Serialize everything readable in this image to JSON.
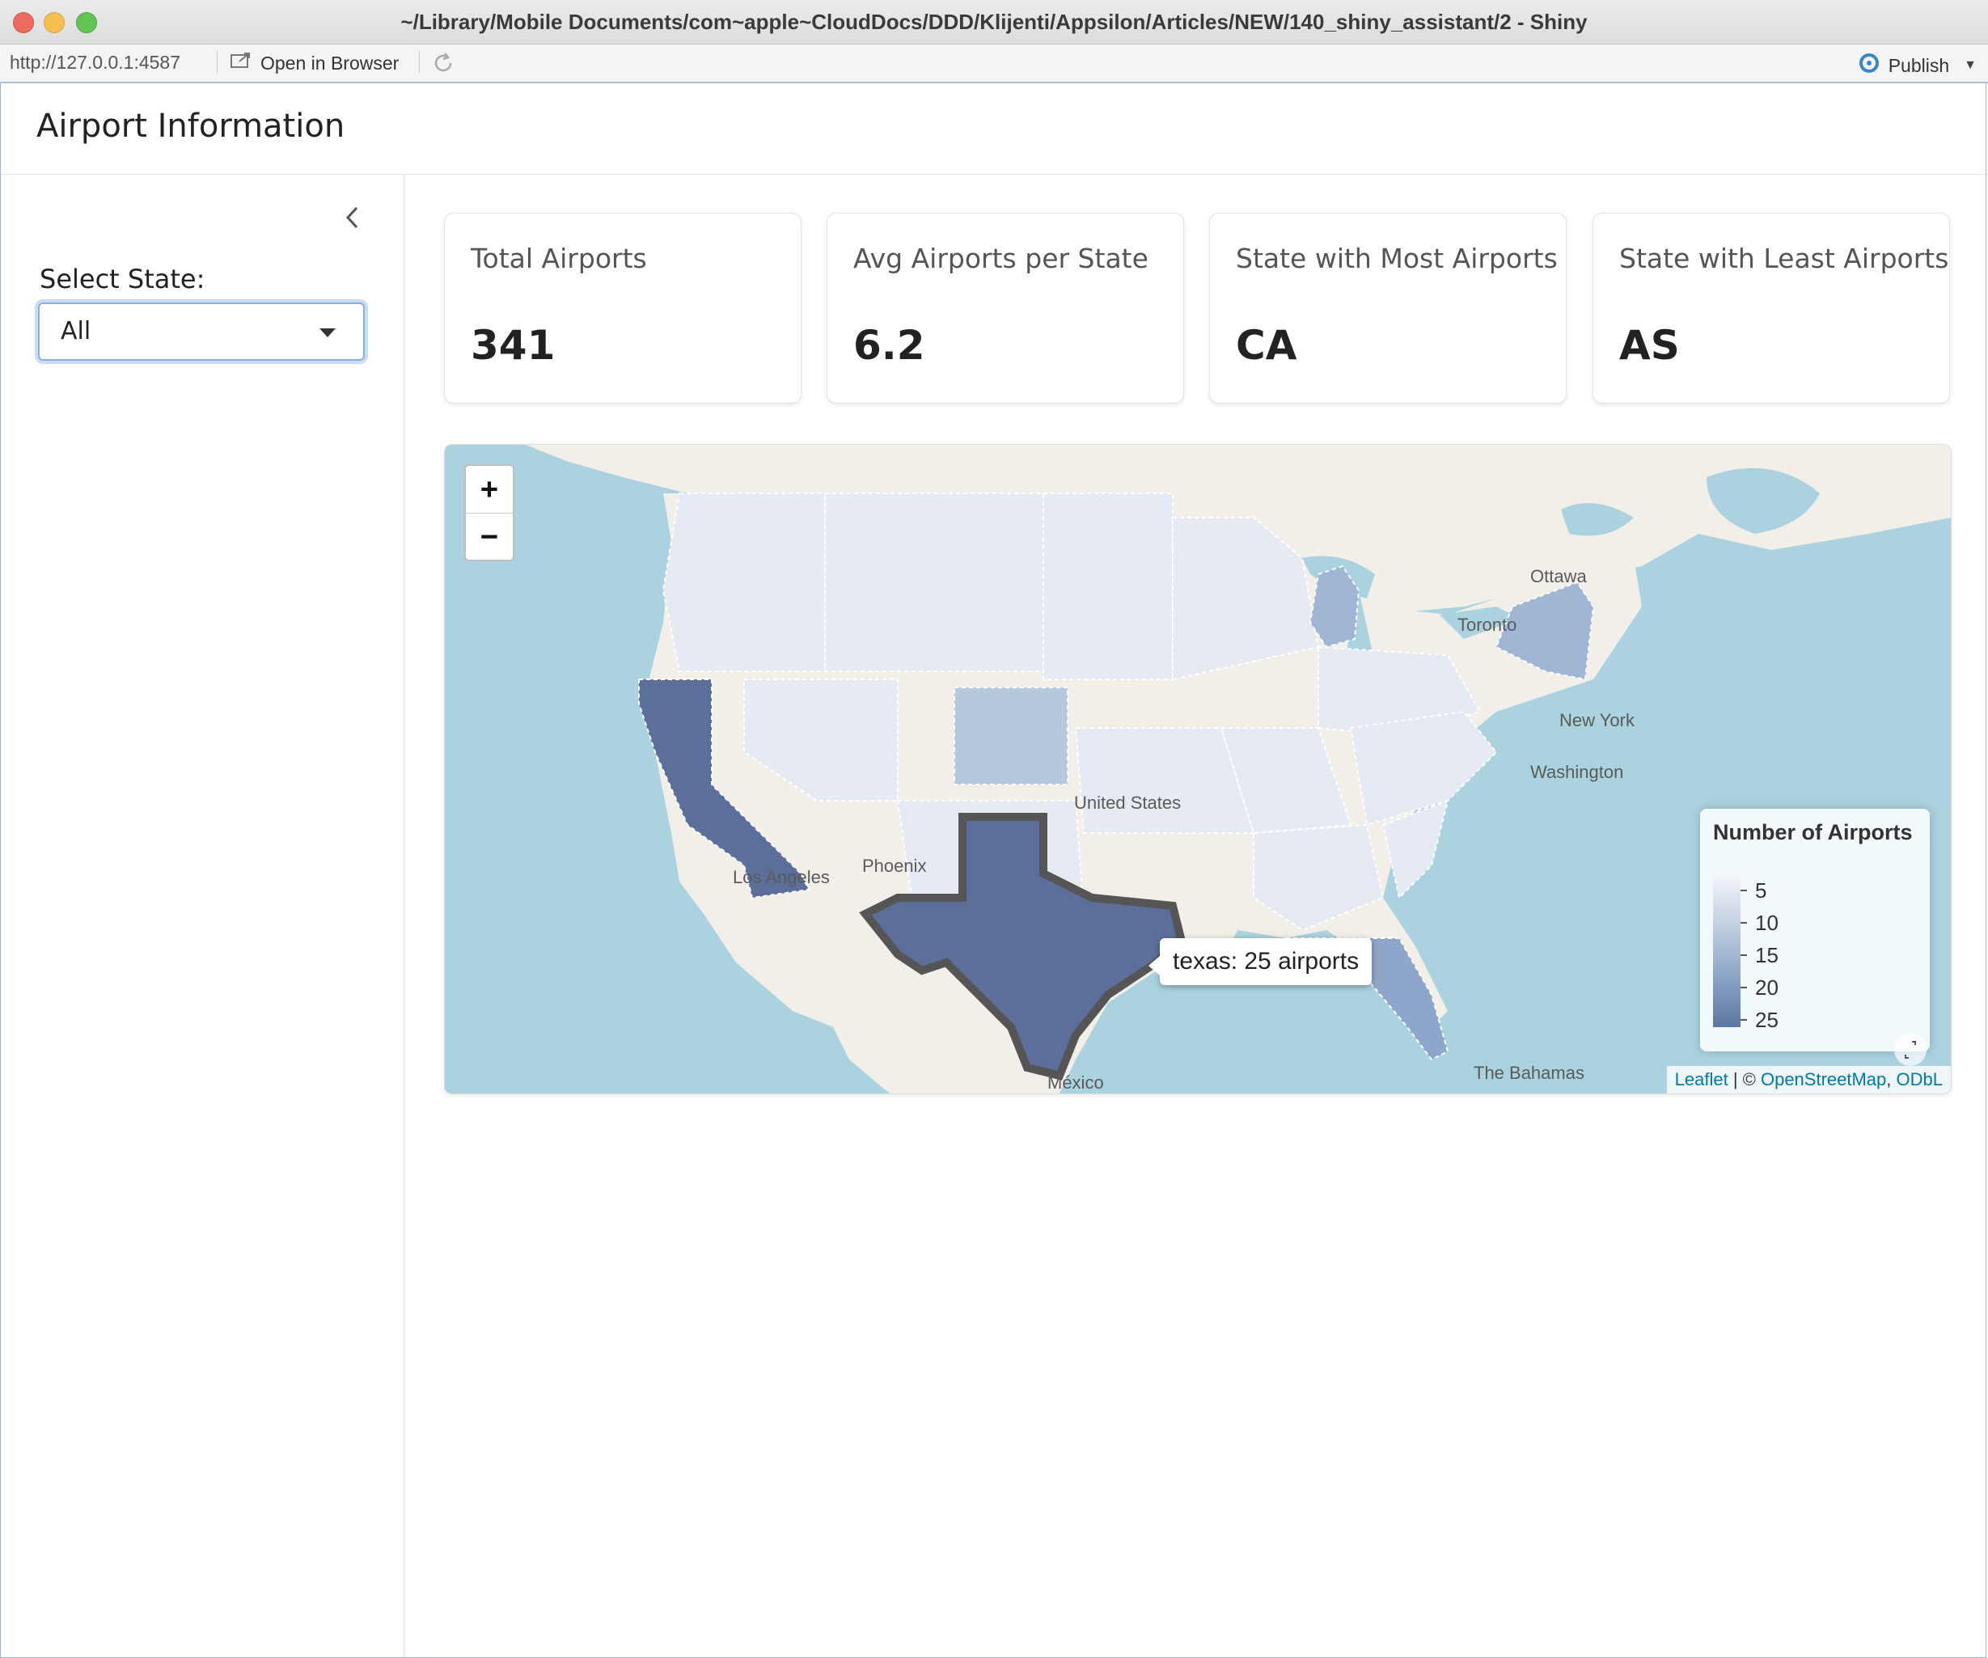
{
  "window": {
    "title": "~/Library/Mobile Documents/com~apple~CloudDocs/DDD/Klijenti/Appsilon/Articles/NEW/140_shiny_assistant/2 - Shiny"
  },
  "viewer": {
    "url": "http://127.0.0.1:4587",
    "open_in_browser": "Open in Browser",
    "publish": "Publish"
  },
  "app": {
    "title": "Airport Information"
  },
  "sidebar": {
    "select_label": "Select State:",
    "select_value": "All"
  },
  "cards": [
    {
      "title": "Total Airports",
      "value": "341"
    },
    {
      "title": "Avg Airports per State",
      "value": "6.2"
    },
    {
      "title": "State with Most Airports",
      "value": "CA"
    },
    {
      "title": "State with Least Airports",
      "value": "AS"
    }
  ],
  "map": {
    "zoom_in": "+",
    "zoom_out": "−",
    "tooltip": "texas: 25 airports",
    "legend": {
      "title": "Number of Airports",
      "labels": [
        "5",
        "10",
        "15",
        "20",
        "25"
      ],
      "colors": [
        "#f1f4f9",
        "#c4d2e4",
        "#9fb6d4",
        "#7d98bf",
        "#5b6f9a"
      ]
    },
    "cities": {
      "ottawa": "Ottawa",
      "toronto": "Toronto",
      "new_york": "New York",
      "washington": "Washington",
      "united_states": "United States",
      "los_angeles": "Los Angeles",
      "phoenix": "Phoenix",
      "mexico": "México",
      "bahamas": "The Bahamas"
    },
    "attribution": {
      "leaflet": "Leaflet",
      "sep": " | © ",
      "osm": "OpenStreetMap",
      "comma": ", ",
      "odbl": "ODbL"
    },
    "highlighted_states": {
      "california": "#5b6f9a",
      "texas": "#5b6f9a",
      "florida": "#8ea6c9",
      "colorado": "#b6c8dc",
      "michigan": "#9fb6d4",
      "new_york": "#9fb6d4"
    }
  }
}
